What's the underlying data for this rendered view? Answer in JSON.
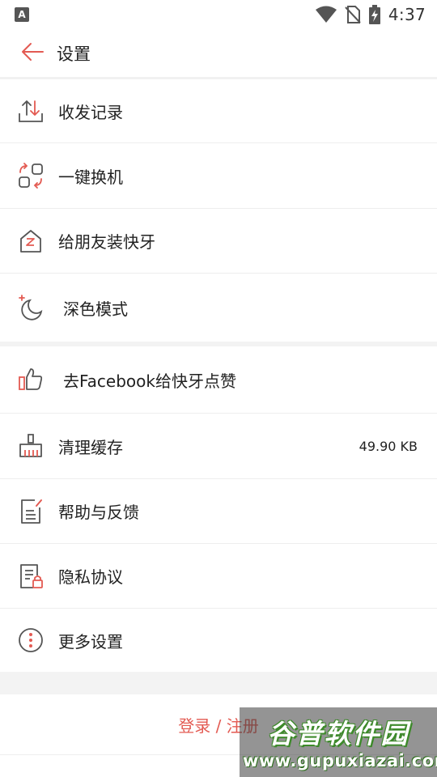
{
  "status_bar": {
    "sim_label": "A",
    "time": "4:37"
  },
  "header": {
    "title": "设置"
  },
  "settings": [
    {
      "label": "收发记录",
      "icon": "transfer-arrows-icon"
    },
    {
      "label": "一键换机",
      "icon": "phone-switch-icon"
    },
    {
      "label": "给朋友装快牙",
      "icon": "house-z-icon"
    },
    {
      "label": "深色模式",
      "icon": "moon-icon"
    },
    {
      "label": "去Facebook给快牙点赞",
      "icon": "thumbs-up-icon"
    },
    {
      "label": "清理缓存",
      "icon": "broom-icon",
      "value": "49.90 KB"
    },
    {
      "label": "帮助与反馈",
      "icon": "feedback-doc-icon"
    },
    {
      "label": "隐私协议",
      "icon": "privacy-doc-icon"
    },
    {
      "label": "更多设置",
      "icon": "more-vertical-icon"
    }
  ],
  "login": {
    "label": "登录 / 注册"
  },
  "watermark": {
    "title": "谷普软件园",
    "url": "www.gupuxiazai.com"
  },
  "colors": {
    "accent": "#e35a52",
    "icon_gray": "#555555",
    "divider": "#eeeeee"
  }
}
